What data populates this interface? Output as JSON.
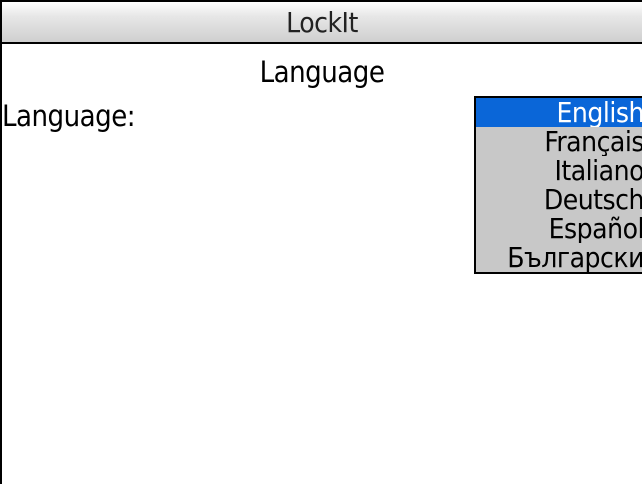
{
  "app": {
    "title": "LockIt"
  },
  "screen": {
    "heading": "Language"
  },
  "language_field": {
    "label": "Language:",
    "selected_value": "English",
    "options": [
      {
        "label": "English",
        "selected": true
      },
      {
        "label": "Français",
        "selected": false
      },
      {
        "label": "Italiano",
        "selected": false
      },
      {
        "label": "Deutsch",
        "selected": false
      },
      {
        "label": "Español",
        "selected": false
      },
      {
        "label": "Български",
        "selected": false
      }
    ]
  },
  "colors": {
    "selection_highlight": "#0a66d8",
    "list_background": "#c8c8c8",
    "title_bar_gradient_top": "#ffffff",
    "title_bar_gradient_bottom": "#cfcfcf"
  }
}
